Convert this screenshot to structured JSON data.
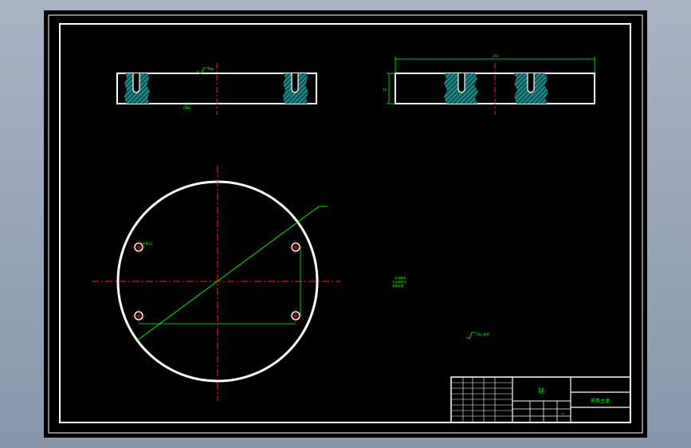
{
  "drawing": {
    "title_block": {
      "part_name": "钻",
      "drawing_name": "夹具主体",
      "scale": "1:1"
    },
    "annotations": {
      "dimension_top": "250",
      "dimension_side": "16",
      "hole_callout": "4-Φ12",
      "surface_mark_1": "Ra",
      "surface_mark_2": "√Ra",
      "note_line_1": "技术要求",
      "note_line_2": "去毛刺锐边",
      "note_line_3": "调质处理",
      "roughness_other": "√Ra 其余"
    }
  },
  "colors": {
    "background": "#000000",
    "outline": "#ffffff",
    "dimension": "#00ff00",
    "centerline": "#ff2020",
    "hatch": "#20b0b0"
  }
}
